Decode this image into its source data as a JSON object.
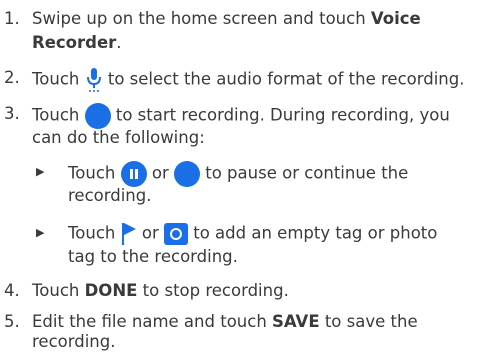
{
  "steps": [
    {
      "num": "1.",
      "a": "Swipe up on the home screen and touch ",
      "bold": "Voice",
      "bold2": "Recorder",
      "b": "."
    },
    {
      "num": "2.",
      "a": "Touch",
      "b": "to select the audio format of the recording.",
      "icon": "microphone-icon"
    },
    {
      "num": "3.",
      "a": "Touch",
      "b": "to start recording. During recording, you",
      "c": "can do the following:",
      "icon": "record-circle-icon"
    },
    {
      "num": "4.",
      "a": "Touch ",
      "bold": "DONE",
      "b": " to stop recording."
    },
    {
      "num": "5.",
      "a": "Edit the file name and touch ",
      "bold": "SAVE",
      "b": " to save the",
      "c": "recording."
    }
  ],
  "sub": [
    {
      "bullet": "▶",
      "a": "Touch",
      "or": "or",
      "b": "to pause or continue the",
      "c": "recording.",
      "icon1": "pause-icon",
      "icon2": "record-circle-icon"
    },
    {
      "bullet": "▶",
      "a": "Touch",
      "or": "or",
      "b": "to add an empty tag or photo",
      "c": "tag to the recording.",
      "icon1": "flag-icon",
      "icon2": "camera-icon"
    }
  ],
  "colors": {
    "accent": "#1a6fe6",
    "text": "#3a3a3a"
  }
}
